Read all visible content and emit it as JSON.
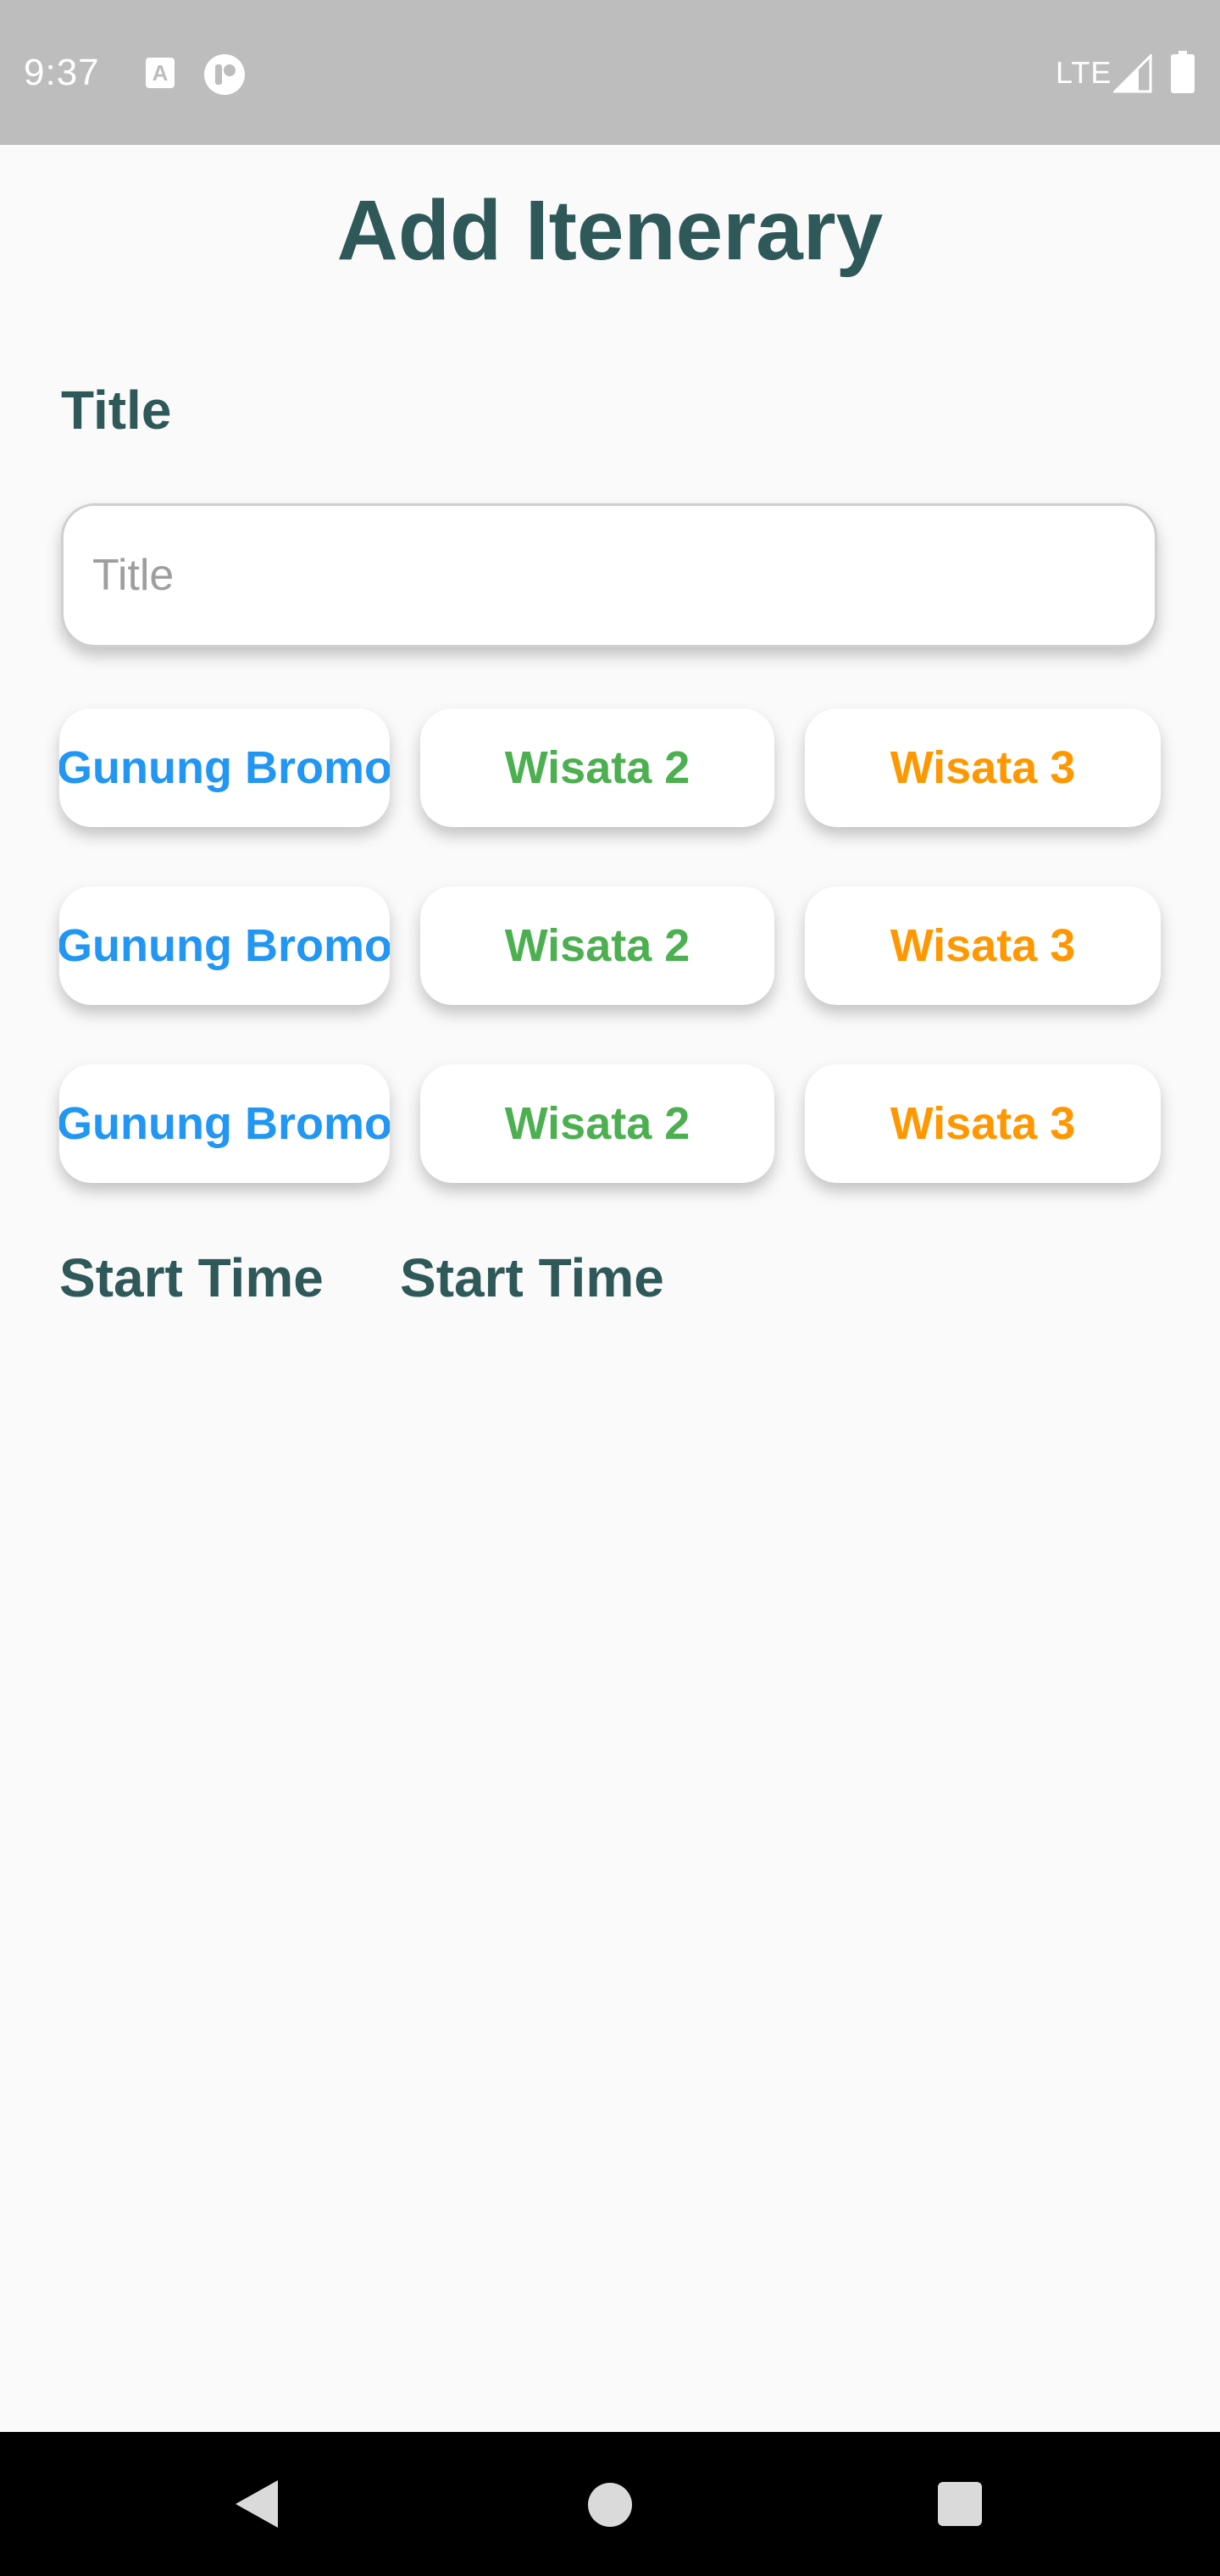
{
  "status_bar": {
    "time": "9:37",
    "notif_icon_letter": "A",
    "network": "LTE",
    "icons": [
      "text-notification-icon",
      "app-notification-icon",
      "signal-icon",
      "battery-icon"
    ]
  },
  "page": {
    "title": "Add Itenerary",
    "title_label": "Title",
    "title_input": {
      "value": "",
      "placeholder": "Title"
    }
  },
  "chip_rows": [
    [
      "Gunung Bromo",
      "Wisata 2",
      "Wisata 3"
    ],
    [
      "Gunung Bromo",
      "Wisata 2",
      "Wisata 3"
    ],
    [
      "Gunung Bromo",
      "Wisata 2",
      "Wisata 3"
    ]
  ],
  "time_labels": {
    "start_time_1": "Start Time",
    "start_time_2": "Start Time"
  },
  "colors": {
    "heading": "#2f5859",
    "status_bar": "#bdbdbd",
    "chip_blue": "#2196f3",
    "chip_green": "#4caf50",
    "chip_orange": "#ff9800",
    "nav_bar": "#000000"
  },
  "nav_bar": {
    "icons": [
      "back-icon",
      "home-icon",
      "recents-icon"
    ]
  }
}
